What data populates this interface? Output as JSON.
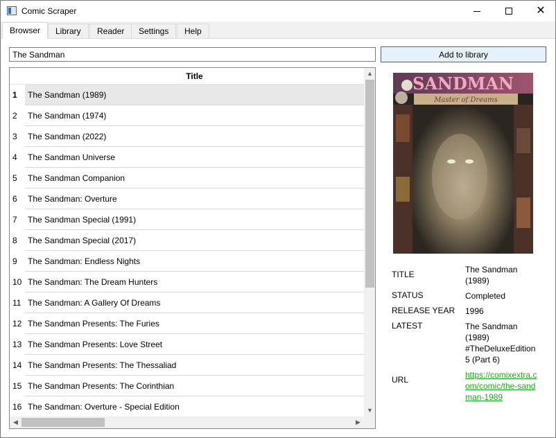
{
  "window": {
    "title": "Comic Scraper"
  },
  "tabs": [
    {
      "label": "Browser",
      "active": true
    },
    {
      "label": "Library",
      "active": false
    },
    {
      "label": "Reader",
      "active": false
    },
    {
      "label": "Settings",
      "active": false
    },
    {
      "label": "Help",
      "active": false
    }
  ],
  "search": {
    "value": "The Sandman"
  },
  "add_button": {
    "label": "Add to library"
  },
  "table": {
    "header": "Title",
    "selected_index": 0,
    "rows": [
      {
        "num": "1",
        "title": "The Sandman (1989)"
      },
      {
        "num": "2",
        "title": "The Sandman (1974)"
      },
      {
        "num": "3",
        "title": "The Sandman (2022)"
      },
      {
        "num": "4",
        "title": "The Sandman Universe"
      },
      {
        "num": "5",
        "title": "The Sandman Companion"
      },
      {
        "num": "6",
        "title": "The Sandman: Overture"
      },
      {
        "num": "7",
        "title": "The Sandman Special (1991)"
      },
      {
        "num": "8",
        "title": "The Sandman Special (2017)"
      },
      {
        "num": "9",
        "title": "The Sandman: Endless Nights"
      },
      {
        "num": "10",
        "title": "The Sandman: The Dream Hunters"
      },
      {
        "num": "11",
        "title": "The Sandman: A Gallery Of Dreams"
      },
      {
        "num": "12",
        "title": "The Sandman Presents: The Furies"
      },
      {
        "num": "13",
        "title": "The Sandman Presents: Love Street"
      },
      {
        "num": "14",
        "title": "The Sandman Presents: The Thessaliad"
      },
      {
        "num": "15",
        "title": "The Sandman Presents: The Corinthian"
      },
      {
        "num": "16",
        "title": "The Sandman: Overture - Special Edition"
      }
    ]
  },
  "cover": {
    "title_text": "SANDMAN",
    "subtitle_text": "Master of Dreams",
    "colors": {
      "title": "#f2a8c4",
      "banner": "#c9b08a",
      "frame": "#5a3b2a",
      "face": "#bfb396"
    }
  },
  "details": {
    "title": {
      "label": "TITLE",
      "value": "The Sandman (1989)"
    },
    "status": {
      "label": "STATUS",
      "value": "Completed"
    },
    "release_year": {
      "label": "RELEASE YEAR",
      "value": "1996"
    },
    "latest": {
      "label": "LATEST",
      "value": "The Sandman (1989) #TheDeluxeEdition 5 (Part 6)"
    },
    "url": {
      "label": "URL",
      "value": "https://comixextra.com/comic/the-sandman-1989"
    }
  },
  "icons": {
    "app": "app-window-icon",
    "minimize": "minimize-icon",
    "maximize": "maximize-icon",
    "close": "close-icon"
  }
}
